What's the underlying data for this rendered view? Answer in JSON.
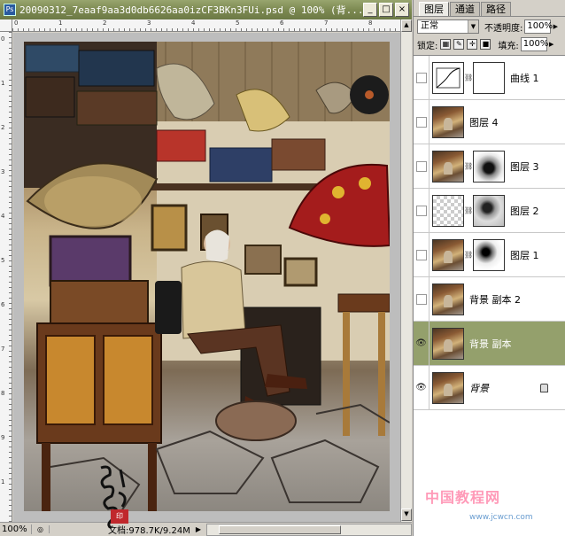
{
  "document": {
    "title": "20090312_7eaaf9aa3d0db6626aa0izCF3BKn3FUi.psd @ 100% (背...",
    "icon_label": "Ps",
    "zoom": "100%",
    "doc_info": "文档:978.7K/9.24M",
    "ruler_top_ticks": [
      "0",
      "1",
      "2",
      "3",
      "4",
      "5",
      "6",
      "7",
      "8"
    ],
    "ruler_left_ticks": [
      "0",
      "1",
      "2",
      "3",
      "4",
      "5",
      "6",
      "7",
      "8",
      "9",
      "1"
    ],
    "window_buttons": {
      "minimize": "_",
      "maximize": "□",
      "close": "×"
    }
  },
  "panel": {
    "tabs": [
      {
        "label": "图层",
        "active": true
      },
      {
        "label": "通道",
        "active": false
      },
      {
        "label": "路径",
        "active": false
      }
    ],
    "blend_mode": "正常",
    "opacity_label": "不透明度:",
    "opacity_value": "100%",
    "lock_label": "锁定:",
    "fill_label": "填充:",
    "fill_value": "100%",
    "layers": [
      {
        "name": "曲线 1",
        "visible": false,
        "thumb": "curves",
        "mask": "white",
        "selected": false,
        "locked": false
      },
      {
        "name": "图层 4",
        "visible": false,
        "thumb": "photo",
        "mask": null,
        "selected": false,
        "locked": false
      },
      {
        "name": "图层 3",
        "visible": false,
        "thumb": "photo",
        "mask": "m3",
        "selected": false,
        "locked": false
      },
      {
        "name": "图层 2",
        "visible": false,
        "thumb": "trans",
        "mask": "m2",
        "selected": false,
        "locked": false
      },
      {
        "name": "图层 1",
        "visible": false,
        "thumb": "photo",
        "mask": "m1",
        "selected": false,
        "locked": false
      },
      {
        "name": "背景 副本 2",
        "visible": false,
        "thumb": "photo",
        "mask": null,
        "selected": false,
        "locked": false
      },
      {
        "name": "背景 副本",
        "visible": true,
        "thumb": "photo",
        "mask": null,
        "selected": true,
        "locked": false
      },
      {
        "name": "背景",
        "visible": true,
        "thumb": "photo",
        "mask": null,
        "selected": false,
        "locked": true
      }
    ]
  },
  "watermark": {
    "text": "中国教程网",
    "url": "www.jcwcn.com",
    "seal": "印"
  },
  "colors": {
    "title_bar": "#7d8a52",
    "selected_layer": "#94a06c",
    "ui_gray": "#d4d0c8"
  },
  "icons": [
    "document-icon",
    "minimize-icon",
    "maximize-icon",
    "close-icon",
    "eye-icon",
    "link-chain-icon",
    "lock-icon"
  ]
}
